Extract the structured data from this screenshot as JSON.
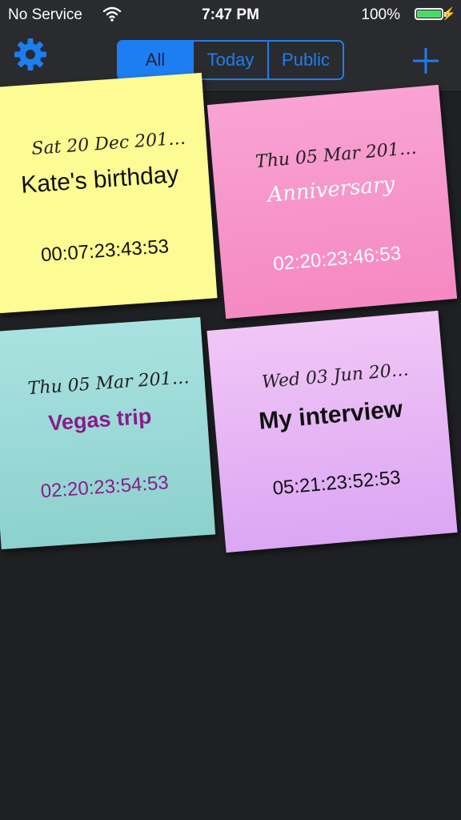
{
  "status_bar": {
    "carrier": "No Service",
    "time": "7:47 PM",
    "battery": "100%",
    "battery_level": 1.0
  },
  "nav": {
    "settings_icon": "gear-icon",
    "add_icon": "plus-icon",
    "accent_color": "#1d7ef2",
    "segments": [
      "All",
      "Today",
      "Public"
    ],
    "selected_segment": "All"
  },
  "notes": [
    {
      "date": "Sat 20 Dec 201…",
      "title": "Kate's birthday",
      "countdown": "00:07:23:43:53",
      "color": "#fdfb93"
    },
    {
      "date": "Thu 05 Mar 201…",
      "title": "Anniversary",
      "countdown": "02:20:23:46:53",
      "color": "#f78fc6"
    },
    {
      "date": "Thu 05 Mar 201…",
      "title": "Vegas trip",
      "countdown": "02:20:23:54:53",
      "color": "#9dd9d6"
    },
    {
      "date": "Wed 03 Jun 20…",
      "title": "My interview",
      "countdown": "05:21:23:52:53",
      "color": "#e5b4f5"
    }
  ]
}
